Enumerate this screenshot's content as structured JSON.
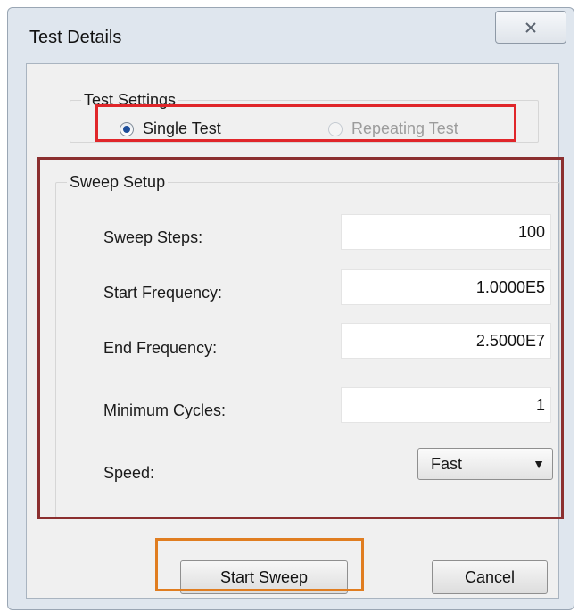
{
  "dialog": {
    "title": "Test Details"
  },
  "test_settings": {
    "legend": "Test Settings",
    "options": [
      {
        "label": "Single Test",
        "selected": true,
        "enabled": true
      },
      {
        "label": "Repeating Test",
        "selected": false,
        "enabled": false
      }
    ]
  },
  "sweep_setup": {
    "legend": "Sweep Setup",
    "fields": [
      {
        "label": "Sweep Steps:",
        "value": "100"
      },
      {
        "label": "Start Frequency:",
        "value": "1.0000E5"
      },
      {
        "label": "End Frequency:",
        "value": "2.5000E7"
      },
      {
        "label": "Minimum Cycles:",
        "value": "1"
      }
    ],
    "speed": {
      "label": "Speed:",
      "value": "Fast"
    }
  },
  "buttons": {
    "start": "Start Sweep",
    "cancel": "Cancel"
  },
  "highlight_colors": {
    "test_settings": "#e0262a",
    "sweep_setup": "#8b2f2f",
    "start_button": "#e07d20"
  },
  "icons": {
    "close": "close-x-icon",
    "dropdown": "chevron-down-icon"
  }
}
